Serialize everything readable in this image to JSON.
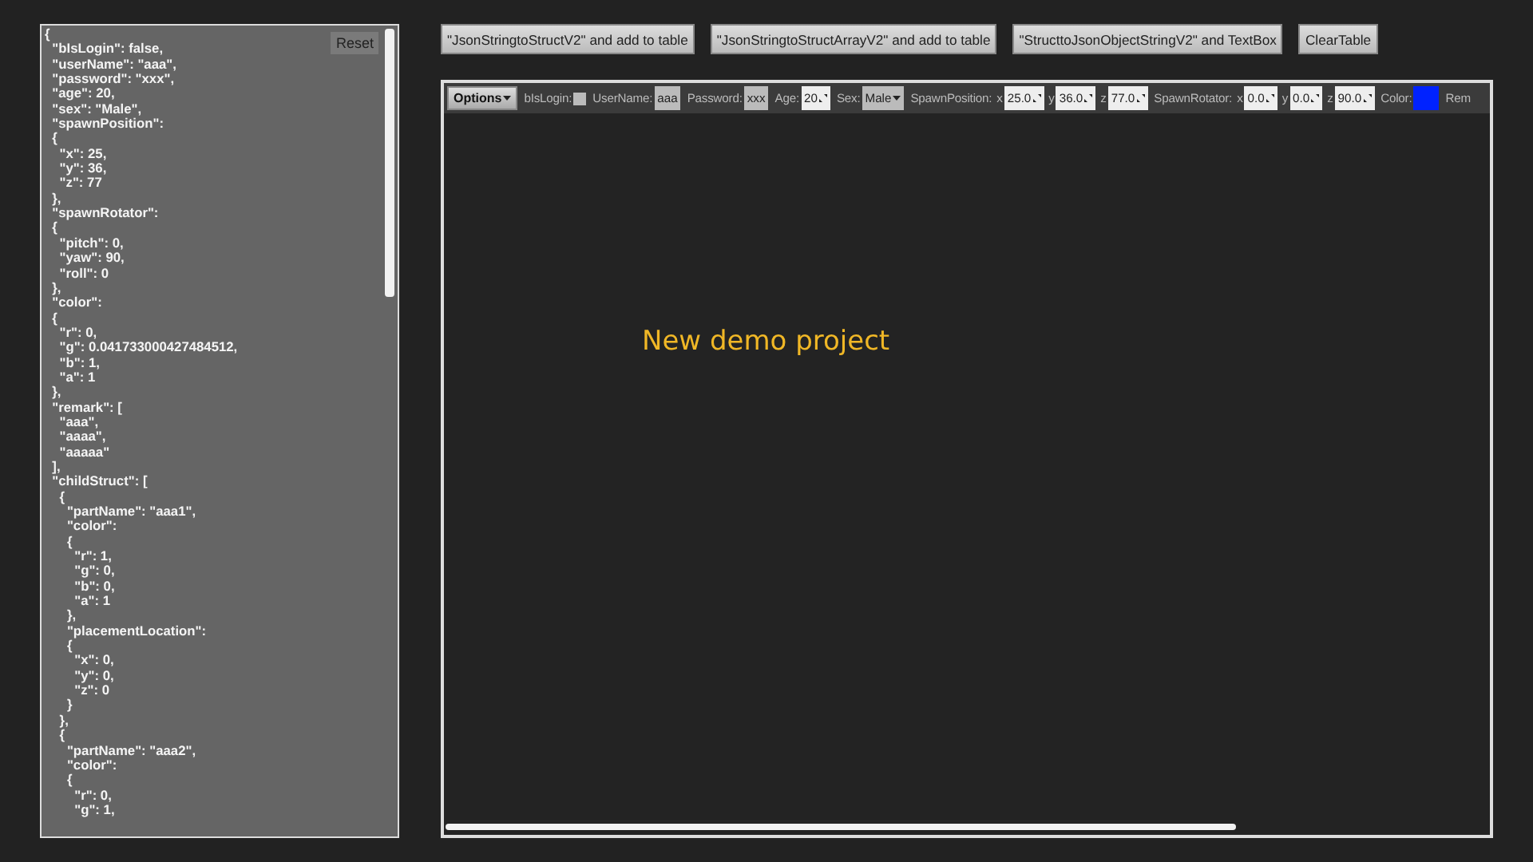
{
  "text_panel": {
    "reset_button": "Reset",
    "content": "{\n  \"bIsLogin\": false,\n  \"userName\": \"aaa\",\n  \"password\": \"xxx\",\n  \"age\": 20,\n  \"sex\": \"Male\",\n  \"spawnPosition\":\n  {\n    \"x\": 25,\n    \"y\": 36,\n    \"z\": 77\n  },\n  \"spawnRotator\":\n  {\n    \"pitch\": 0,\n    \"yaw\": 90,\n    \"roll\": 0\n  },\n  \"color\":\n  {\n    \"r\": 0,\n    \"g\": 0.041733000427484512,\n    \"b\": 1,\n    \"a\": 1\n  },\n  \"remark\": [\n    \"aaa\",\n    \"aaaa\",\n    \"aaaaa\"\n  ],\n  \"childStruct\": [\n    {\n      \"partName\": \"aaa1\",\n      \"color\":\n      {\n        \"r\": 1,\n        \"g\": 0,\n        \"b\": 0,\n        \"a\": 1\n      },\n      \"placementLocation\":\n      {\n        \"x\": 0,\n        \"y\": 0,\n        \"z\": 0\n      }\n    },\n    {\n      \"partName\": \"aaa2\",\n      \"color\":\n      {\n        \"r\": 0,\n        \"g\": 1,"
  },
  "action_buttons": [
    "\"JsonStringtoStructV2\" and add to table",
    "\"JsonStringtoStructArrayV2\" and add to table",
    "\"StructtoJsonObjectStringV2\" and TextBox",
    "ClearTable"
  ],
  "toolbar": {
    "options_menu": "Options",
    "fields": [
      {
        "kind": "checkbox",
        "label": "bIsLogin:",
        "checked": false
      },
      {
        "kind": "text",
        "label": "UserName:",
        "value": "aaa"
      },
      {
        "kind": "text",
        "label": "Password:",
        "value": "xxx"
      },
      {
        "kind": "spinner",
        "label": "Age:",
        "value": "20"
      },
      {
        "kind": "dropdown",
        "label": "Sex:",
        "value": "Male"
      },
      {
        "kind": "vector",
        "label": "SpawnPosition:",
        "components": [
          {
            "axis": "x",
            "value": "25.0"
          },
          {
            "axis": "y",
            "value": "36.0"
          },
          {
            "axis": "z",
            "value": "77.0"
          }
        ]
      },
      {
        "kind": "vector",
        "label": "SpawnRotator:",
        "components": [
          {
            "axis": "x",
            "value": "0.0"
          },
          {
            "axis": "y",
            "value": "0.0"
          },
          {
            "axis": "z",
            "value": "90.0"
          }
        ]
      },
      {
        "kind": "color",
        "label": "Color:",
        "color": "#0022ff"
      },
      {
        "kind": "label",
        "label": "Rem"
      }
    ]
  },
  "viewport": {
    "title": "New demo project"
  }
}
